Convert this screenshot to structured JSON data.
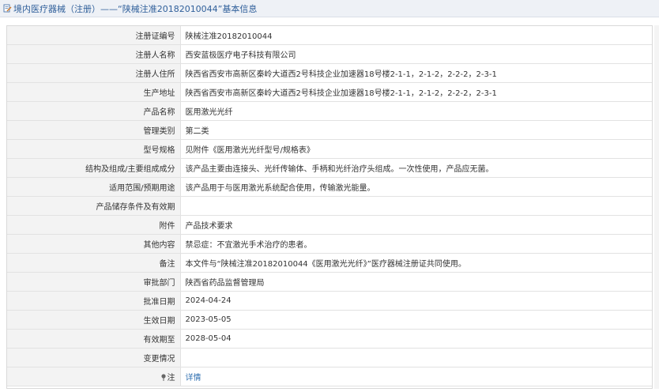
{
  "header": {
    "icon": "document-edit-icon",
    "title": "境内医疗器械（注册）——“陕械注准20182010044”基本信息"
  },
  "rows": [
    {
      "label": "注册证编号",
      "value": "陕械注准20182010044"
    },
    {
      "label": "注册人名称",
      "value": "西安蓝极医疗电子科技有限公司"
    },
    {
      "label": "注册人住所",
      "value": "陕西省西安市高新区秦岭大道西2号科技企业加速器18号楼2-1-1，2-1-2，2-2-2，2-3-1"
    },
    {
      "label": "生产地址",
      "value": "陕西省西安市高新区秦岭大道西2号科技企业加速器18号楼2-1-1，2-1-2，2-2-2，2-3-1"
    },
    {
      "label": "产品名称",
      "value": "医用激光光纤"
    },
    {
      "label": "管理类别",
      "value": "第二类"
    },
    {
      "label": "型号规格",
      "value": "见附件《医用激光光纤型号/规格表》"
    },
    {
      "label": "结构及组成/主要组成成分",
      "value": "该产品主要由连接头、光纤传输体、手柄和光纤治疗头组成。一次性使用，产品应无菌。"
    },
    {
      "label": "适用范围/预期用途",
      "value": "该产品用于与医用激光系统配合使用，传输激光能量。"
    },
    {
      "label": "产品储存条件及有效期",
      "value": ""
    },
    {
      "label": "附件",
      "value": "产品技术要求"
    },
    {
      "label": "其他内容",
      "value": "禁忌症：不宜激光手术治疗的患者。"
    },
    {
      "label": "备注",
      "value": "本文件与“陕械注准20182010044《医用激光光纤》”医疗器械注册证共同使用。"
    },
    {
      "label": "审批部门",
      "value": "陕西省药品监督管理局"
    },
    {
      "label": "批准日期",
      "value": "2024-04-24"
    },
    {
      "label": "生效日期",
      "value": "2023-05-05"
    },
    {
      "label": "有效期至",
      "value": "2028-05-04"
    },
    {
      "label": "变更情况",
      "value": ""
    }
  ],
  "note_row": {
    "icon": "pin-icon",
    "label": "注",
    "link_text": "详情"
  }
}
